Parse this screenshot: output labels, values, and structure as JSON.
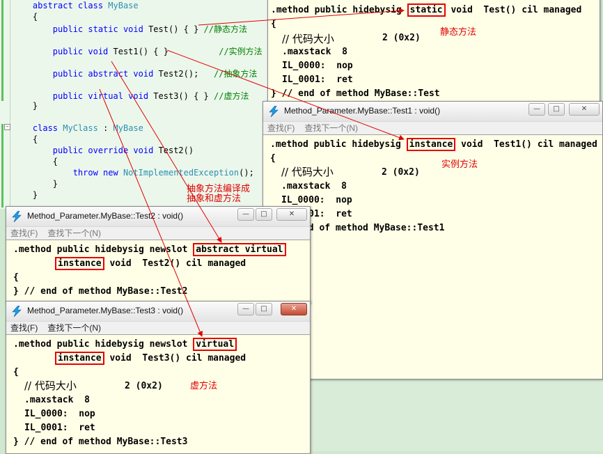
{
  "editor": {
    "lines": [
      {
        "indent": "    ",
        "parts": [
          [
            "kw",
            "abstract class "
          ],
          [
            "ty",
            "MyBase"
          ]
        ]
      },
      {
        "indent": "    ",
        "parts": [
          [
            "",
            "{"
          ]
        ]
      },
      {
        "indent": "        ",
        "parts": [
          [
            "kw",
            "public static void "
          ],
          [
            "",
            "Test() { }"
          ],
          [
            "cm",
            " //静态方法"
          ]
        ]
      },
      {
        "indent": "        ",
        "parts": [
          [
            "kw",
            "public void "
          ],
          [
            "",
            "Test1() { }"
          ],
          [
            "cm",
            "          //实例方法"
          ]
        ]
      },
      {
        "indent": "        ",
        "parts": [
          [
            "kw",
            "public abstract void "
          ],
          [
            "",
            "Test2();"
          ],
          [
            "cm",
            "   //抽象方法"
          ]
        ]
      },
      {
        "indent": "        ",
        "parts": [
          [
            "kw",
            "public virtual void "
          ],
          [
            "",
            "Test3() { } "
          ],
          [
            "cm",
            "//虚方法"
          ]
        ]
      },
      {
        "indent": "    ",
        "parts": [
          [
            "",
            "}"
          ]
        ]
      },
      {
        "indent": "    ",
        "parts": [
          [
            "kw",
            "class "
          ],
          [
            "ty",
            "MyClass"
          ],
          [
            "",
            " : "
          ],
          [
            "ty",
            "MyBase"
          ]
        ]
      },
      {
        "indent": "    ",
        "parts": [
          [
            "",
            "{"
          ]
        ]
      },
      {
        "indent": "        ",
        "parts": [
          [
            "kw",
            "public override void "
          ],
          [
            "",
            "Test2()"
          ]
        ]
      },
      {
        "indent": "        ",
        "parts": [
          [
            "",
            "{"
          ]
        ]
      },
      {
        "indent": "            ",
        "parts": [
          [
            "kw",
            "throw new "
          ],
          [
            "ty",
            "NotImplementedException"
          ],
          [
            "",
            "();"
          ]
        ]
      },
      {
        "indent": "        ",
        "parts": [
          [
            "",
            "}"
          ]
        ]
      },
      {
        "indent": "    ",
        "parts": [
          [
            "",
            "}"
          ]
        ]
      }
    ]
  },
  "windows": {
    "test": {
      "l1_pre": ".method public hidebysig ",
      "l1_box": "static",
      "l1_post": " void  Test() cil managed",
      "brace": "{",
      "code_size_comment": "// 代码大小",
      "code_size_value": "2 (0x2)",
      "maxstack": ".maxstack  8",
      "il0": "IL_0000:  nop",
      "il1": "IL_0001:  ret",
      "end": "} // end of method MyBase::Test"
    },
    "test1": {
      "title": "Method_Parameter.MyBase::Test1 : void()",
      "menu_find": "查找(F)",
      "menu_next": "查找下一个(N)",
      "l1_pre": ".method public hidebysig ",
      "l1_box": "instance",
      "l1_post": " void  Test1() cil managed",
      "brace": "{",
      "code_size_comment": "// 代码大小",
      "code_size_value": "2 (0x2)",
      "maxstack": ".maxstack  8",
      "il0": "IL_0000:  nop",
      "il1": "IL_0001:  ret",
      "end": "} // end of method MyBase::Test1"
    },
    "test2": {
      "title": "Method_Parameter.MyBase::Test2 : void()",
      "menu_find": "查找(F)",
      "menu_next": "查找下一个(N)",
      "l1_pre": ".method public hidebysig newslot ",
      "l1_box": "abstract virtual",
      "l2_box": "instance",
      "l2_post": " void  Test2() cil managed",
      "brace": "{",
      "end": "} // end of method MyBase::Test2"
    },
    "test3": {
      "title": "Method_Parameter.MyBase::Test3 : void()",
      "menu_find": "查找(F)",
      "menu_next": "查找下一个(N)",
      "l1_pre": ".method public hidebysig newslot ",
      "l1_box": "virtual",
      "l2_box": "instance",
      "l2_post": " void  Test3() cil managed",
      "brace": "{",
      "code_size_comment": "// 代码大小",
      "code_size_value": "2 (0x2)",
      "maxstack": ".maxstack  8",
      "il0": "IL_0000:  nop",
      "il1": "IL_0001:  ret",
      "end": "} // end of method MyBase::Test3"
    }
  },
  "notes": {
    "static": "静态方法",
    "instance": "实例方法",
    "abstract_line1": "抽象方法编译成",
    "abstract_line2": "抽象和虚方法",
    "virtual": "虚方法"
  },
  "buttons": {
    "minimize": "—",
    "maximize": "□",
    "close": "✕"
  },
  "colors": {
    "annotation": "#e00000",
    "il_background": "#ffffe8",
    "editor_background": "#ecf7ec"
  }
}
